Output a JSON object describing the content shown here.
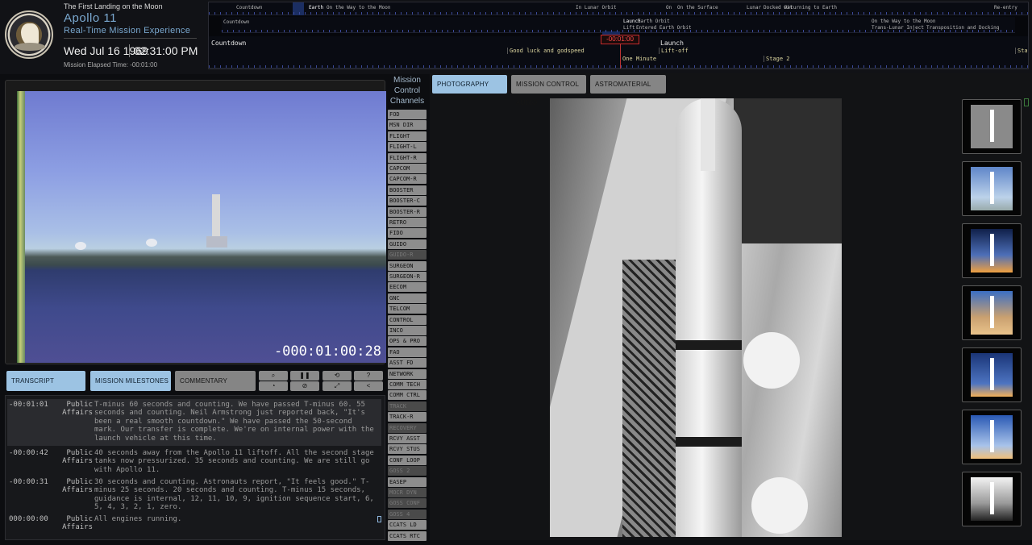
{
  "header": {
    "subtitle": "The First Landing on the Moon",
    "title": "Apollo 11",
    "tagline": "Real-Time Mission Experience",
    "date": "Wed Jul 16 1969",
    "time": "02:31:00 PM",
    "met_label": "Mission Elapsed Time: -00:01:00",
    "logo": "apollo-11-mission-patch"
  },
  "timeline": {
    "row1": [
      "Countdown",
      "Earth",
      "On the Way to the Moon",
      "In Lunar Orbit",
      "On",
      "On the Surface",
      "Lunar",
      "Docked wit",
      "Returning to Earth",
      "Re-entry"
    ],
    "row2_left": "Countdown",
    "row2_mid_a": "Launch",
    "row2_mid_b": "Earth Orbit",
    "row2_mid_c": "Lift",
    "row2_mid_d": "Entered Earth Orbit",
    "row2_right_a": "On the Way to the Moon",
    "row2_right_b": "Trans-Lunar Inject",
    "row2_right_c": "Transposition and Docking",
    "row3_phase_left": "Countdown",
    "row3_phase_right": "Launch",
    "row3_event_a": "Good luck and godspeed",
    "row3_event_b": "Lift-off",
    "row3_event_c": "One Minute",
    "row3_event_d": "Stage 2",
    "row3_event_e": "Sta",
    "now_marker": "-00:01:00"
  },
  "video": {
    "time": "-000:01:00:28"
  },
  "tabs": {
    "transcript": "TRANSCRIPT",
    "milestones": "MISSION MILESTONES",
    "commentary": "COMMENTARY"
  },
  "controls": [
    "search-icon",
    "pause-icon",
    "history-icon",
    "help-icon",
    "speed-icon",
    "mute-icon",
    "fullscreen-icon",
    "share-icon"
  ],
  "controls_glyphs": [
    "⌕",
    "❚❚",
    "⟲",
    "?",
    "◔",
    "⊘",
    "⤢",
    "<"
  ],
  "transcript": [
    {
      "time": "-00:01:01",
      "speaker": "Public Affairs",
      "text": "T-minus 60 seconds and counting. We have passed T-minus 60. 55 seconds and counting. Neil Armstrong just reported back, \"It's been a real smooth countdown.\" We have passed the 50-second mark. Our transfer is complete. We're on internal power with the launch vehicle at this time."
    },
    {
      "time": "-00:00:42",
      "speaker": "Public Affairs",
      "text": "40 seconds away from the Apollo 11 liftoff. All the second stage tanks now pressurized. 35 seconds and counting. We are still go with Apollo 11."
    },
    {
      "time": "-00:00:31",
      "speaker": "Public Affairs",
      "text": "30 seconds and counting. Astronauts report, \"It feels good.\" T-minus 25 seconds. 20 seconds and counting. T-minus 15 seconds, guidance is internal, 12, 11, 10, 9, ignition sequence start, 6, 5, 4, 3, 2, 1, zero."
    },
    {
      "time": "000:00:00",
      "speaker": "Public Affairs",
      "text": "All engines running."
    }
  ],
  "channels": {
    "title": "Mission Control Channels",
    "items": [
      {
        "label": "FOD",
        "on": true
      },
      {
        "label": "MSN DIR",
        "on": true
      },
      {
        "label": "FLIGHT",
        "on": true
      },
      {
        "label": "FLIGHT-L",
        "on": true
      },
      {
        "label": "FLIGHT-R",
        "on": true
      },
      {
        "label": "CAPCOM",
        "on": true
      },
      {
        "label": "CAPCOM-R",
        "on": true
      },
      {
        "label": "BOOSTER",
        "on": true
      },
      {
        "label": "BOOSTER-C",
        "on": true
      },
      {
        "label": "BOOSTER-R",
        "on": true
      },
      {
        "label": "RETRO",
        "on": true
      },
      {
        "label": "FIDO",
        "on": true
      },
      {
        "label": "GUIDO",
        "on": true
      },
      {
        "label": "GUIDO-R",
        "on": false
      },
      {
        "label": "SURGEON",
        "on": true
      },
      {
        "label": "SURGEON-R",
        "on": true
      },
      {
        "label": "EECOM",
        "on": true
      },
      {
        "label": "GNC",
        "on": true
      },
      {
        "label": "TELCOM",
        "on": true
      },
      {
        "label": "CONTROL",
        "on": true
      },
      {
        "label": "INCO",
        "on": true
      },
      {
        "label": "OPS & PRO",
        "on": true
      },
      {
        "label": "FAO",
        "on": true
      },
      {
        "label": "ASST FD",
        "on": true
      },
      {
        "label": "NETWORK",
        "on": true
      },
      {
        "label": "COMM TECH",
        "on": true
      },
      {
        "label": "COMM CTRL",
        "on": true
      },
      {
        "label": "TRACK",
        "on": false
      },
      {
        "label": "TRACK-R",
        "on": true
      },
      {
        "label": "RECOVERY",
        "on": false
      },
      {
        "label": "RCVY ASST",
        "on": true
      },
      {
        "label": "RCVY STUS",
        "on": true
      },
      {
        "label": "CONF LOOP",
        "on": true
      },
      {
        "label": "GOSS 2",
        "on": false
      },
      {
        "label": "EASEP",
        "on": true
      },
      {
        "label": "MOCR DYN",
        "on": false
      },
      {
        "label": "GOSS CONF",
        "on": false
      },
      {
        "label": "GOSS 4",
        "on": false
      },
      {
        "label": "CCATS LD",
        "on": true
      },
      {
        "label": "CCATS RTC",
        "on": true
      }
    ]
  },
  "media_tabs": {
    "photography": "PHOTOGRAPHY",
    "audio": "MISSION CONTROL AUDIO",
    "samples": "ASTROMATERIAL SAMPLES"
  },
  "colors": {
    "accent_blue": "#9cc3e3",
    "button_grey": "#858585",
    "title_blue": "#7aa8cf",
    "now_red": "#c52b2b"
  }
}
